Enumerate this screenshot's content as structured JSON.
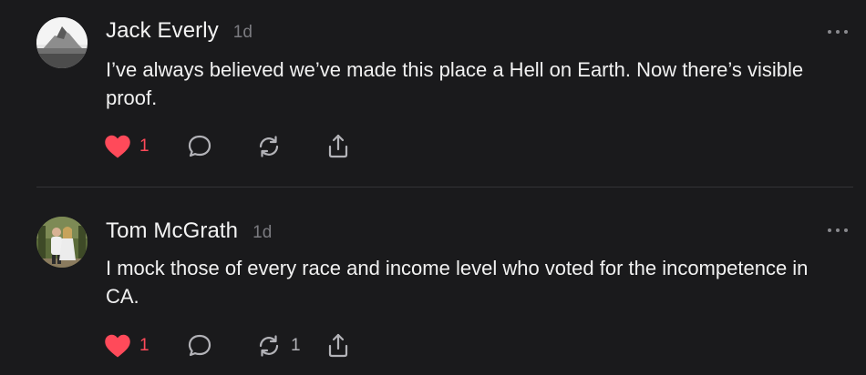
{
  "posts": [
    {
      "author": "Jack Everly",
      "time": "1d",
      "text": "I’ve always believed we’ve made this place a Hell on Earth. Now there’s visible proof.",
      "avatar_icon": "volcano-photo-avatar",
      "likes": "1",
      "liked": true,
      "reposts": ""
    },
    {
      "author": "Tom McGrath",
      "time": "1d",
      "text": "I mock those of every race and income level who voted for the incompetence in CA.",
      "avatar_icon": "couple-photo-avatar",
      "likes": "1",
      "liked": true,
      "reposts": "1"
    }
  ],
  "colors": {
    "background": "#1a1a1c",
    "like_active": "#ff4a5a",
    "icon": "#b3b3b8",
    "muted_text": "#7b7b80",
    "divider": "#333336"
  },
  "icons": [
    "heart-icon",
    "comment-icon",
    "repost-icon",
    "share-icon",
    "more-icon"
  ]
}
